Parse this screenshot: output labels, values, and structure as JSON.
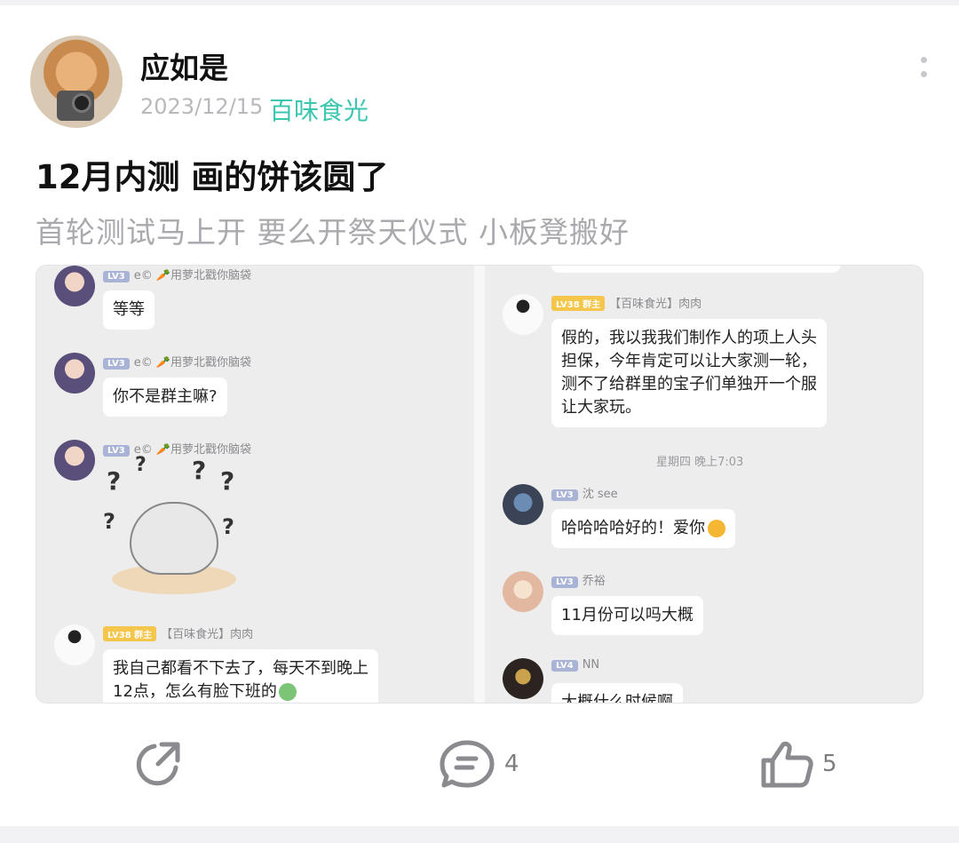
{
  "post": {
    "username": "应如是",
    "date": "2023/12/15",
    "channel": "百味食光",
    "title": "12月内测 画的饼该圆了",
    "subtitle": "首轮测试马上开  要么开祭天仪式  小板凳搬好"
  },
  "chat_left": [
    {
      "lv": "LV3",
      "name": "e© 🥕用萝北戳你脑袋",
      "text": "等等"
    },
    {
      "lv": "LV3",
      "name": "e© 🥕用萝北戳你脑袋",
      "text": "你不是群主嘛?"
    },
    {
      "lv": "LV3",
      "name": "e© 🥕用萝北戳你脑袋",
      "text": ""
    },
    {
      "lv": "LV38 群主",
      "name": "【百味食光】肉肉",
      "text1": "我自己都看不下去了，每天不到晚上",
      "text2": "12点，怎么有脸下班的"
    }
  ],
  "chat_right": {
    "owner": {
      "lv": "LV38 群主",
      "name": "【百味食光】肉肉",
      "lines": [
        "假的，我以我我们制作人的项上人头",
        "担保，今年肯定可以让大家测一轮，",
        "测不了给群里的宝子们单独开一个服",
        "让大家玩。"
      ]
    },
    "timestamp": "星期四 晚上7:03",
    "shen": {
      "lv": "LV3",
      "name": "沈 see",
      "text": "哈哈哈哈好的！爱你"
    },
    "qiao": {
      "lv": "LV3",
      "name": "乔裕",
      "text": "11月份可以吗大概"
    },
    "nn": {
      "lv": "LV4",
      "name": "NN",
      "text": "大概什么时候啊"
    }
  },
  "actions": {
    "comments": "4",
    "likes": "5"
  },
  "colors": {
    "accent": "#3cc6b0",
    "muted": "#a9a9ae"
  }
}
